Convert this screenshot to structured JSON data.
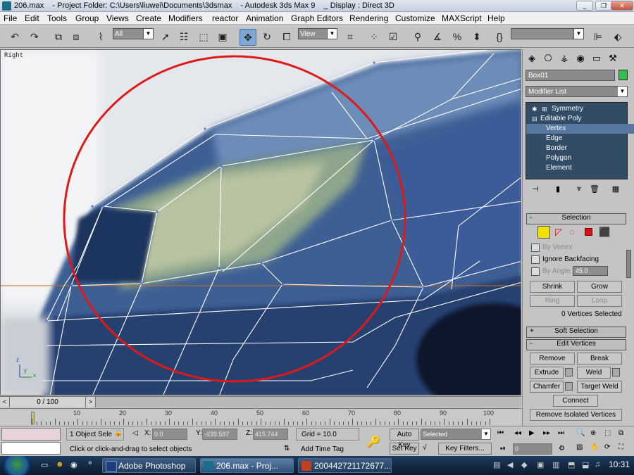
{
  "window": {
    "title": "206.max    - Project Folder: C:\\Users\\liuwei\\Documents\\3dsmax    - Autodesk 3ds Max 9    _ Display : Direct 3D",
    "min_label": "_",
    "max_label": "❐",
    "close_label": "✕"
  },
  "menu": [
    "File",
    "Edit",
    "Tools",
    "Group",
    "Views",
    "Create",
    "Modifiers",
    "reactor",
    "Animation",
    "Graph Editors",
    "Rendering",
    "Customize",
    "MAXScript",
    "Help"
  ],
  "toolbar": {
    "selection_filter": "All",
    "ref_coord": "View",
    "named_selection": ""
  },
  "viewport": {
    "label": "Right",
    "axis_x": "x",
    "axis_y": "y",
    "axis_z": "z"
  },
  "command_panel": {
    "object_name": "Box01",
    "object_color": "#2fbf4f",
    "modifier_list": "Modifier List",
    "stack": [
      "Symmetry",
      "Editable Poly",
      "Vertex",
      "Edge",
      "Border",
      "Polygon",
      "Element"
    ],
    "selection_rollout": "Selection",
    "by_vertex": "By Vertex",
    "ignore_backfacing": "Ignore Backfacing",
    "by_angle": "By Angle:",
    "by_angle_value": "45.0",
    "shrink": "Shrink",
    "grow": "Grow",
    "ring": "Ring",
    "loop": "Loop",
    "status": "0 Vertices Selected",
    "soft_selection": "Soft Selection",
    "edit_vertices": "Edit Vertices",
    "remove": "Remove",
    "break": "Break",
    "extrude": "Extrude",
    "weld": "Weld",
    "chamfer": "Chamfer",
    "target_weld": "Target Weld",
    "connect": "Connect",
    "remove_isolated": "Remove Isolated Vertices"
  },
  "timeline": {
    "frame": "0 / 100",
    "prev": "<",
    "next": ">",
    "ticks": [
      "10",
      "20",
      "30",
      "40",
      "50",
      "60",
      "70",
      "80",
      "90",
      "100"
    ]
  },
  "status": {
    "selection": "1 Object Sele",
    "x_label": "X:",
    "x_value": "0.0",
    "y_label": "Y:",
    "y_value": "-639.587",
    "z_label": "Z:",
    "z_value": "415.744",
    "grid": "Grid = 10.0",
    "prompt": "Click or click-and-drag to select objects",
    "add_time_tag": "Add Time Tag",
    "auto_key": "Auto Key",
    "set_key": "Set Key",
    "selected": "Selected",
    "key_filters": "Key Filters...",
    "frame_value": "0"
  },
  "taskbar": {
    "items": [
      "Adobe Photoshop",
      "206.max    - Proj...",
      "200442721172677..."
    ],
    "clock": "10:31"
  }
}
